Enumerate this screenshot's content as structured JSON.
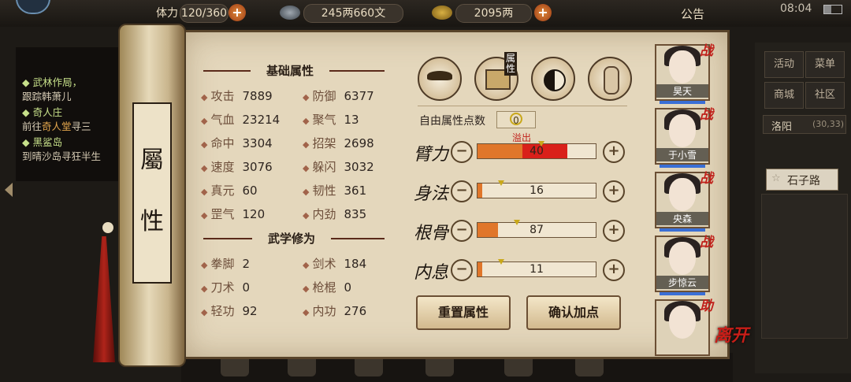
{
  "topbar": {
    "stamina_label": "体力",
    "stamina_value": "120/360",
    "copper": "245两660文",
    "gold": "2095两",
    "announcement": "公告",
    "clock": "08:04"
  },
  "quests": [
    {
      "head": "武林作局，",
      "sub": "跟踪韩萧儿"
    },
    {
      "head": "奇人庄",
      "sub_prefix": "前往",
      "sub_gold": "奇人堂",
      "sub_suffix": "寻三"
    },
    {
      "head": "黑鲨岛",
      "sub": "到晴沙岛寻狂半生"
    }
  ],
  "city": {
    "buttons": [
      "活动",
      "菜单",
      "商城",
      "社区"
    ],
    "location": "洛阳",
    "coords": "(30,33)",
    "street": "石子路"
  },
  "panel": {
    "title": [
      "屬",
      "性"
    ],
    "base_header": "基础属性",
    "martial_header": "武学修为",
    "base_stats": [
      {
        "label": "攻击",
        "value": "7889"
      },
      {
        "label": "防御",
        "value": "6377"
      },
      {
        "label": "气血",
        "value": "23214"
      },
      {
        "label": "聚气",
        "value": "13"
      },
      {
        "label": "命中",
        "value": "3304"
      },
      {
        "label": "招架",
        "value": "2698"
      },
      {
        "label": "速度",
        "value": "3076"
      },
      {
        "label": "躲闪",
        "value": "3032"
      },
      {
        "label": "真元",
        "value": "60"
      },
      {
        "label": "韧性",
        "value": "361"
      },
      {
        "label": "罡气",
        "value": "120"
      },
      {
        "label": "内劲",
        "value": "835"
      }
    ],
    "martial_stats": [
      {
        "label": "拳脚",
        "value": "2"
      },
      {
        "label": "剑术",
        "value": "184"
      },
      {
        "label": "刀术",
        "value": "0"
      },
      {
        "label": "枪棍",
        "value": "0"
      },
      {
        "label": "轻功",
        "value": "92"
      },
      {
        "label": "内功",
        "value": "276"
      }
    ],
    "tab_label": "属性",
    "free_points_label": "自由属性点数",
    "free_points": "0",
    "overflow_label": "溢出",
    "attributes": [
      {
        "name": "臂力",
        "value": "40",
        "level": 0.38,
        "overflow": 0.38
      },
      {
        "name": "身法",
        "value": "16",
        "level": 0.04,
        "overflow": 0
      },
      {
        "name": "根骨",
        "value": "87",
        "level": 0.17,
        "overflow": 0
      },
      {
        "name": "内息",
        "value": "11",
        "level": 0.03,
        "overflow": 0
      }
    ],
    "reset_button": "重置属性",
    "confirm_button": "确认加点"
  },
  "party": [
    {
      "name": "昊天",
      "tag": "战"
    },
    {
      "name": "于小雪",
      "tag": "战"
    },
    {
      "name": "央森",
      "tag": "战"
    },
    {
      "name": "步惊云",
      "tag": "战"
    },
    {
      "name": "",
      "tag": "助"
    }
  ],
  "leave_label": "离开",
  "colors": {
    "overflow": "#d9201a",
    "fill": "#e0762a",
    "paper": "#e4d7bc"
  }
}
